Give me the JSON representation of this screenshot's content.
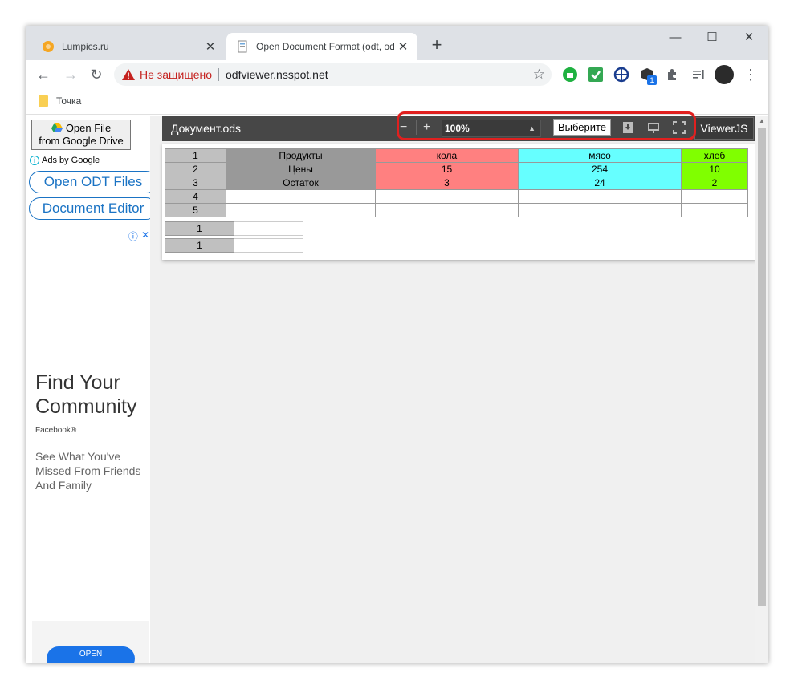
{
  "browser": {
    "tabs": [
      {
        "title": "Lumpics.ru",
        "close": "✕"
      },
      {
        "title": "Open Document Format (odt, od",
        "close": "✕"
      }
    ],
    "new_tab": "+",
    "window_controls": {
      "minimize": "—",
      "maximize": "☐",
      "close": "✕"
    },
    "security_warning": "Не защищено",
    "url": "odfviewer.nsspot.net",
    "bookmark": "Точка",
    "extension_badge": "1"
  },
  "sidebar": {
    "gdrive_line1": "Open File",
    "gdrive_line2": "from Google Drive",
    "ads_by": "Ads by Google",
    "open_odt": "Open ODT Files",
    "doc_editor": "Document Editor",
    "ad": {
      "headline": "Find Your Community",
      "source": "Facebook®",
      "description": "See What You've Missed From Friends And Family",
      "cta": "OPEN"
    }
  },
  "viewer": {
    "doc_name": "Документ.ods",
    "zoom_out": "−",
    "zoom_in": "+",
    "zoom": "100%",
    "select_label": "Выберите",
    "brand": "ViewerJS"
  },
  "sheet": {
    "rows": [
      {
        "n": "1",
        "a": "Продукты",
        "b": "кола",
        "c": "мясо",
        "d": "хлеб"
      },
      {
        "n": "2",
        "a": "Цены",
        "b": "15",
        "c": "254",
        "d": "10"
      },
      {
        "n": "3",
        "a": "Остаток",
        "b": "3",
        "c": "24",
        "d": "2"
      },
      {
        "n": "4",
        "a": "",
        "b": "",
        "c": "",
        "d": ""
      },
      {
        "n": "5",
        "a": "",
        "b": "",
        "c": "",
        "d": ""
      }
    ],
    "mini_rows": [
      "1",
      "1"
    ]
  }
}
